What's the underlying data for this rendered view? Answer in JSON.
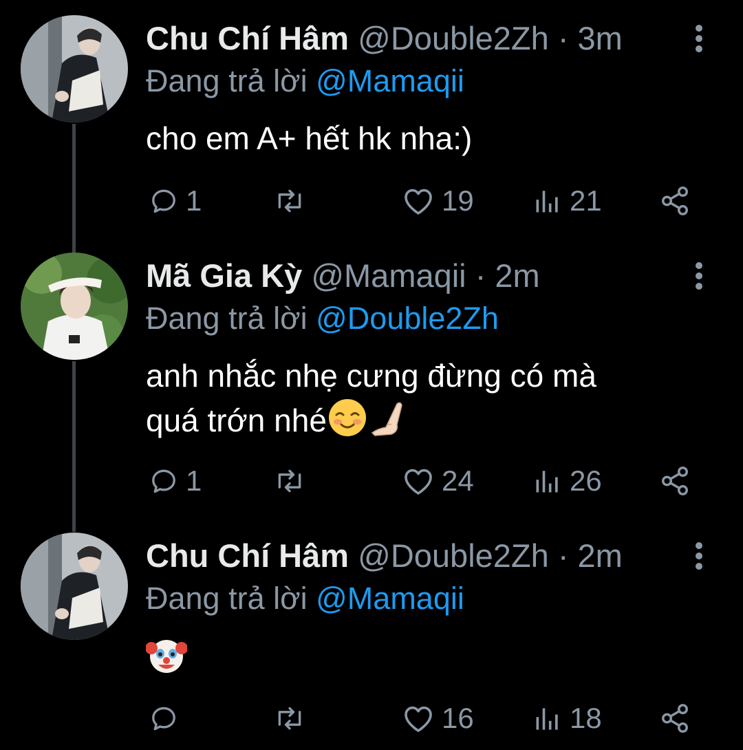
{
  "tweets": [
    {
      "display_name": "Chu Chí Hâm",
      "handle": "@Double2Zh",
      "separator": "·",
      "time": "3m",
      "reply_prefix": "Đang trả lời",
      "reply_to": "@Mamaqii",
      "text": "cho em A+ hết hk nha:)",
      "replies": "1",
      "retweets": "",
      "likes": "19",
      "views": "21"
    },
    {
      "display_name": "Mã Gia Kỳ",
      "handle": "@Mamaqii",
      "separator": "·",
      "time": "2m",
      "reply_prefix": "Đang trả lời",
      "reply_to": "@Double2Zh",
      "text_line1": "anh nhắc nhẹ cưng đừng có mà",
      "text_line2": "quá trớn nhé",
      "replies": "1",
      "retweets": "",
      "likes": "24",
      "views": "26"
    },
    {
      "display_name": "Chu Chí Hâm",
      "handle": "@Double2Zh",
      "separator": "·",
      "time": "2m",
      "reply_prefix": "Đang trả lời",
      "reply_to": "@Mamaqii",
      "text_emoji": "clown-face",
      "replies": "",
      "retweets": "",
      "likes": "16",
      "views": "18"
    }
  ],
  "colors": {
    "background": "#000000",
    "text": "#ffffff",
    "secondary": "#8b98a5",
    "mention": "#1d9bf0",
    "thread_line": "#3d4348"
  },
  "icons": [
    "reply-icon",
    "retweet-icon",
    "like-icon",
    "views-icon",
    "share-icon",
    "more-icon"
  ]
}
